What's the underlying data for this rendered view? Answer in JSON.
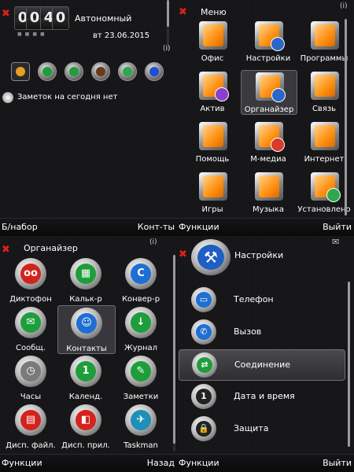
{
  "screen1": {
    "clock": {
      "h1": "0",
      "h2": "0",
      "m1": "4",
      "m2": "0"
    },
    "profile": "Автономный",
    "date": "вт 23.06.2015",
    "signal": "(i)",
    "notes": "Заметок на сегодня нет",
    "softkeys": {
      "left": "Б/набор",
      "right": "Конт-ты"
    }
  },
  "screen2": {
    "title": "Меню",
    "signal": "(i)",
    "items": [
      {
        "label": "Офис",
        "badge": ""
      },
      {
        "label": "Настройки",
        "badge": "#2b66c9"
      },
      {
        "label": "Программы",
        "badge": ""
      },
      {
        "label": "Актив",
        "badge": "#8a3fd0"
      },
      {
        "label": "Органайзер",
        "badge": "#2b66c9"
      },
      {
        "label": "Связь",
        "badge": ""
      },
      {
        "label": "Помощь",
        "badge": ""
      },
      {
        "label": "М-медиа",
        "badge": "#d83a2b"
      },
      {
        "label": "Интернет",
        "badge": ""
      },
      {
        "label": "Игры",
        "badge": ""
      },
      {
        "label": "Музыка",
        "badge": ""
      },
      {
        "label": "Установлено",
        "badge": "#2ea84a"
      }
    ],
    "softkeys": {
      "left": "Функции",
      "right": "Выйти"
    }
  },
  "screen3": {
    "title": "Органайзер",
    "signal": "(i)",
    "items": [
      {
        "label": "Диктофон",
        "color": "#d4231e",
        "glyph": "oo"
      },
      {
        "label": "Кальк-р",
        "color": "#1e9e3a",
        "glyph": "▦"
      },
      {
        "label": "Конвер-р",
        "color": "#1e6fd4",
        "glyph": "C"
      },
      {
        "label": "Сообщ.",
        "color": "#1e9e3a",
        "glyph": "✉"
      },
      {
        "label": "Контакты",
        "color": "#1e6fd4",
        "glyph": "☺"
      },
      {
        "label": "Журнал",
        "color": "#1e9e3a",
        "glyph": "↓"
      },
      {
        "label": "Часы",
        "color": "#7a7a7a",
        "glyph": "◷"
      },
      {
        "label": "Календ.",
        "color": "#1e9e3a",
        "glyph": "1"
      },
      {
        "label": "Заметки",
        "color": "#1e9e3a",
        "glyph": "✎"
      },
      {
        "label": "Дисп. файл.",
        "color": "#d4231e",
        "glyph": "▤"
      },
      {
        "label": "Дисп. прил.",
        "color": "#d4231e",
        "glyph": "◧"
      },
      {
        "label": "Taskman",
        "color": "#1e8fb8",
        "glyph": "✈"
      }
    ],
    "softkeys": {
      "left": "Функции",
      "right": "Назад"
    }
  },
  "screen4": {
    "title": "Настройки",
    "items": [
      {
        "label": "Телефон",
        "color": "#1e6fd4",
        "glyph": "▭"
      },
      {
        "label": "Вызов",
        "color": "#1e6fd4",
        "glyph": "✆"
      },
      {
        "label": "Соединение",
        "color": "#1e9e3a",
        "glyph": "⇄"
      },
      {
        "label": "Дата и время",
        "color": "#222",
        "glyph": "1"
      },
      {
        "label": "Защита",
        "color": "#222",
        "glyph": "🔒"
      }
    ],
    "softkeys": {
      "left": "Функции",
      "right": "Выйти"
    }
  }
}
